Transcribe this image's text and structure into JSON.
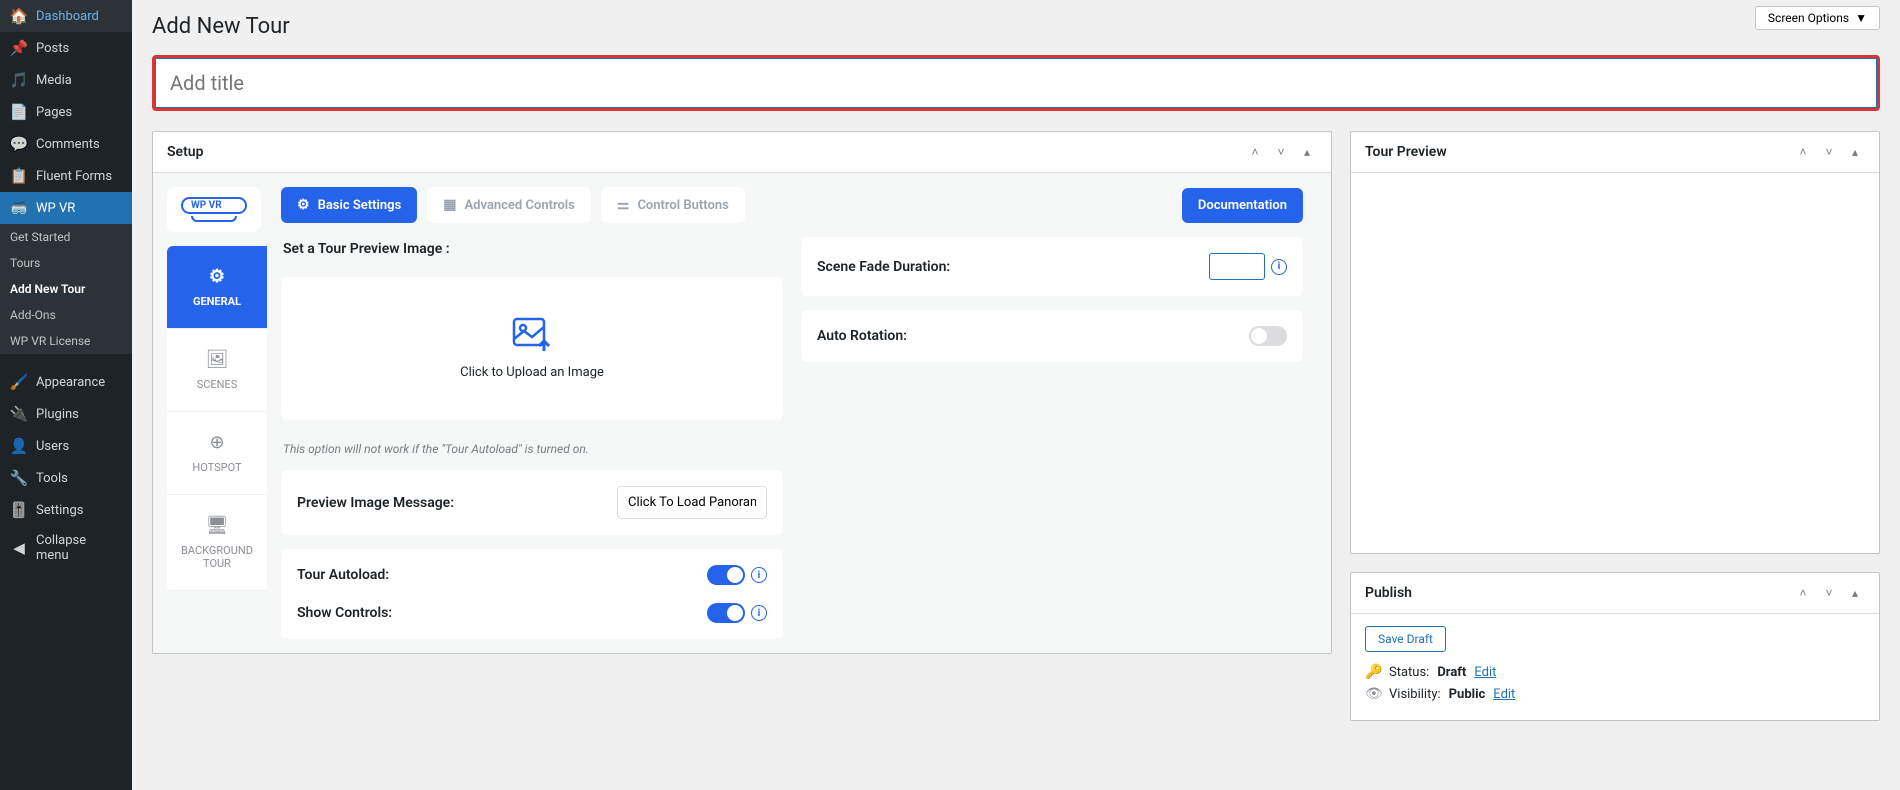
{
  "sidebar": {
    "items": [
      {
        "icon": "dashboard",
        "label": "Dashboard"
      },
      {
        "icon": "pin",
        "label": "Posts"
      },
      {
        "icon": "media",
        "label": "Media"
      },
      {
        "icon": "pages",
        "label": "Pages"
      },
      {
        "icon": "comments",
        "label": "Comments"
      },
      {
        "icon": "forms",
        "label": "Fluent Forms"
      },
      {
        "icon": "vr",
        "label": "WP VR"
      }
    ],
    "sub": [
      {
        "label": "Get Started"
      },
      {
        "label": "Tours"
      },
      {
        "label": "Add New Tour"
      },
      {
        "label": "Add-Ons"
      },
      {
        "label": "WP VR License"
      }
    ],
    "lower": [
      {
        "icon": "appearance",
        "label": "Appearance"
      },
      {
        "icon": "plugins",
        "label": "Plugins"
      },
      {
        "icon": "users",
        "label": "Users"
      },
      {
        "icon": "tools",
        "label": "Tools"
      },
      {
        "icon": "settings",
        "label": "Settings"
      },
      {
        "icon": "collapse",
        "label": "Collapse menu"
      }
    ]
  },
  "top": {
    "screen_options": "Screen Options"
  },
  "page": {
    "title": "Add New Tour",
    "title_placeholder": "Add title"
  },
  "setup": {
    "box_title": "Setup",
    "logo_text": "WP VR",
    "tabs": {
      "basic": "Basic Settings",
      "advanced": "Advanced Controls",
      "control": "Control Buttons",
      "doc": "Documentation"
    },
    "vtabs": {
      "general": "GENERAL",
      "scenes": "SCENES",
      "hotspot": "HOTSPOT",
      "bg": "BACKGROUND TOUR"
    },
    "preview_label": "Set a Tour Preview Image :",
    "upload_text": "Click to Upload an Image",
    "upload_hint": "This option will not work if the \"Tour Autoload\" is turned on.",
    "preview_msg_label": "Preview Image Message:",
    "preview_msg_value": "Click To Load Panoram",
    "autoload_label": "Tour Autoload:",
    "controls_label": "Show Controls:",
    "fade_label": "Scene Fade Duration:",
    "rotation_label": "Auto Rotation:"
  },
  "preview": {
    "box_title": "Tour Preview"
  },
  "publish": {
    "box_title": "Publish",
    "save_draft": "Save Draft",
    "status_label": "Status:",
    "status_value": "Draft",
    "visibility_label": "Visibility:",
    "visibility_value": "Public",
    "edit": "Edit"
  }
}
